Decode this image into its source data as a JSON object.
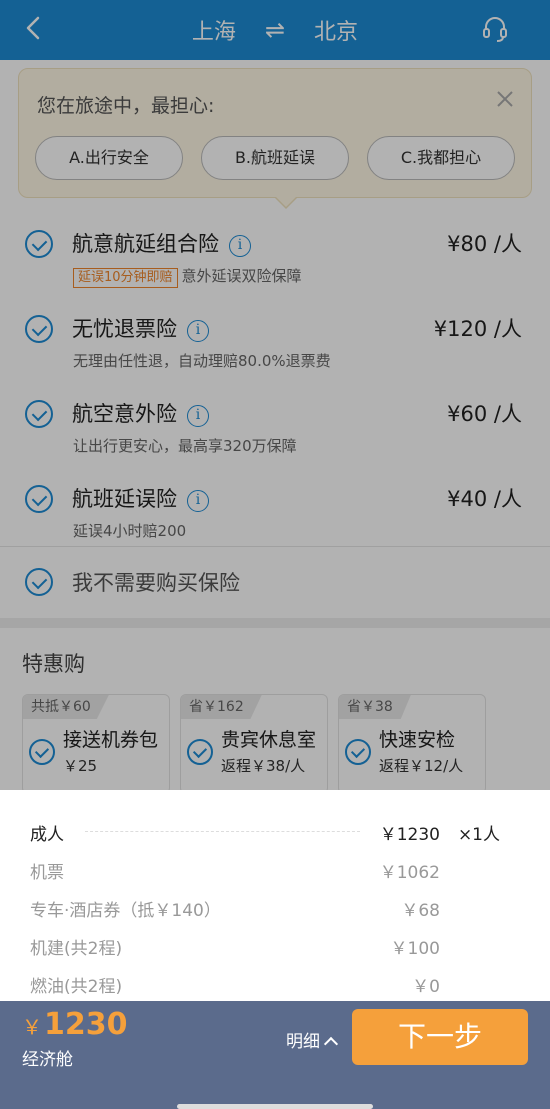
{
  "header": {
    "from": "上海",
    "swap_icon": "⇌",
    "to": "北京"
  },
  "survey": {
    "question": "您在旅途中，最担心:",
    "options": [
      "A.出行安全",
      "B.航班延误",
      "C.我都担心"
    ]
  },
  "insurance": [
    {
      "name": "航意航延组合险",
      "price": "¥80 /人",
      "tag": "延误10分钟即赔",
      "desc": "意外延误双险保障"
    },
    {
      "name": "无忧退票险",
      "price": "¥120 /人",
      "desc": "无理由任性退，自动理赔80.0%退票费"
    },
    {
      "name": "航空意外险",
      "price": "¥60 /人",
      "desc": "让出行更安心，最高享320万保障"
    },
    {
      "name": "航班延误险",
      "price": "¥40 /人",
      "desc": "延误4小时赔200"
    }
  ],
  "no_insurance_label": "我不需要购买保险",
  "specials": {
    "title": "特惠购",
    "cards": [
      {
        "badge": "共抵￥60",
        "name": "接送机券包",
        "price": "￥25"
      },
      {
        "badge": "省￥162",
        "name": "贵宾休息室",
        "price": "返程￥38/人"
      },
      {
        "badge": "省￥38",
        "name": "快速安检",
        "price": "返程￥12/人"
      }
    ]
  },
  "breakdown": {
    "adult": {
      "label": "成人",
      "amount": "￥1230",
      "qty": "×1人"
    },
    "ticket": {
      "label": "机票",
      "amount": "￥1062"
    },
    "car_hotel": {
      "label": "专车·酒店券（抵￥140）",
      "amount": "￥68"
    },
    "airport_fee": {
      "label": "机建(共2程)",
      "amount": "￥100"
    },
    "fuel": {
      "label": "燃油(共2程)",
      "amount": "￥0"
    }
  },
  "footer": {
    "currency": "￥",
    "total": "1230",
    "cabin": "经济舱",
    "detail_label": "明细",
    "next_label": "下一步"
  },
  "colors": {
    "primary": "#1d8bd4",
    "accent": "#f5a03b",
    "footer_bg": "#5b6b8c"
  }
}
